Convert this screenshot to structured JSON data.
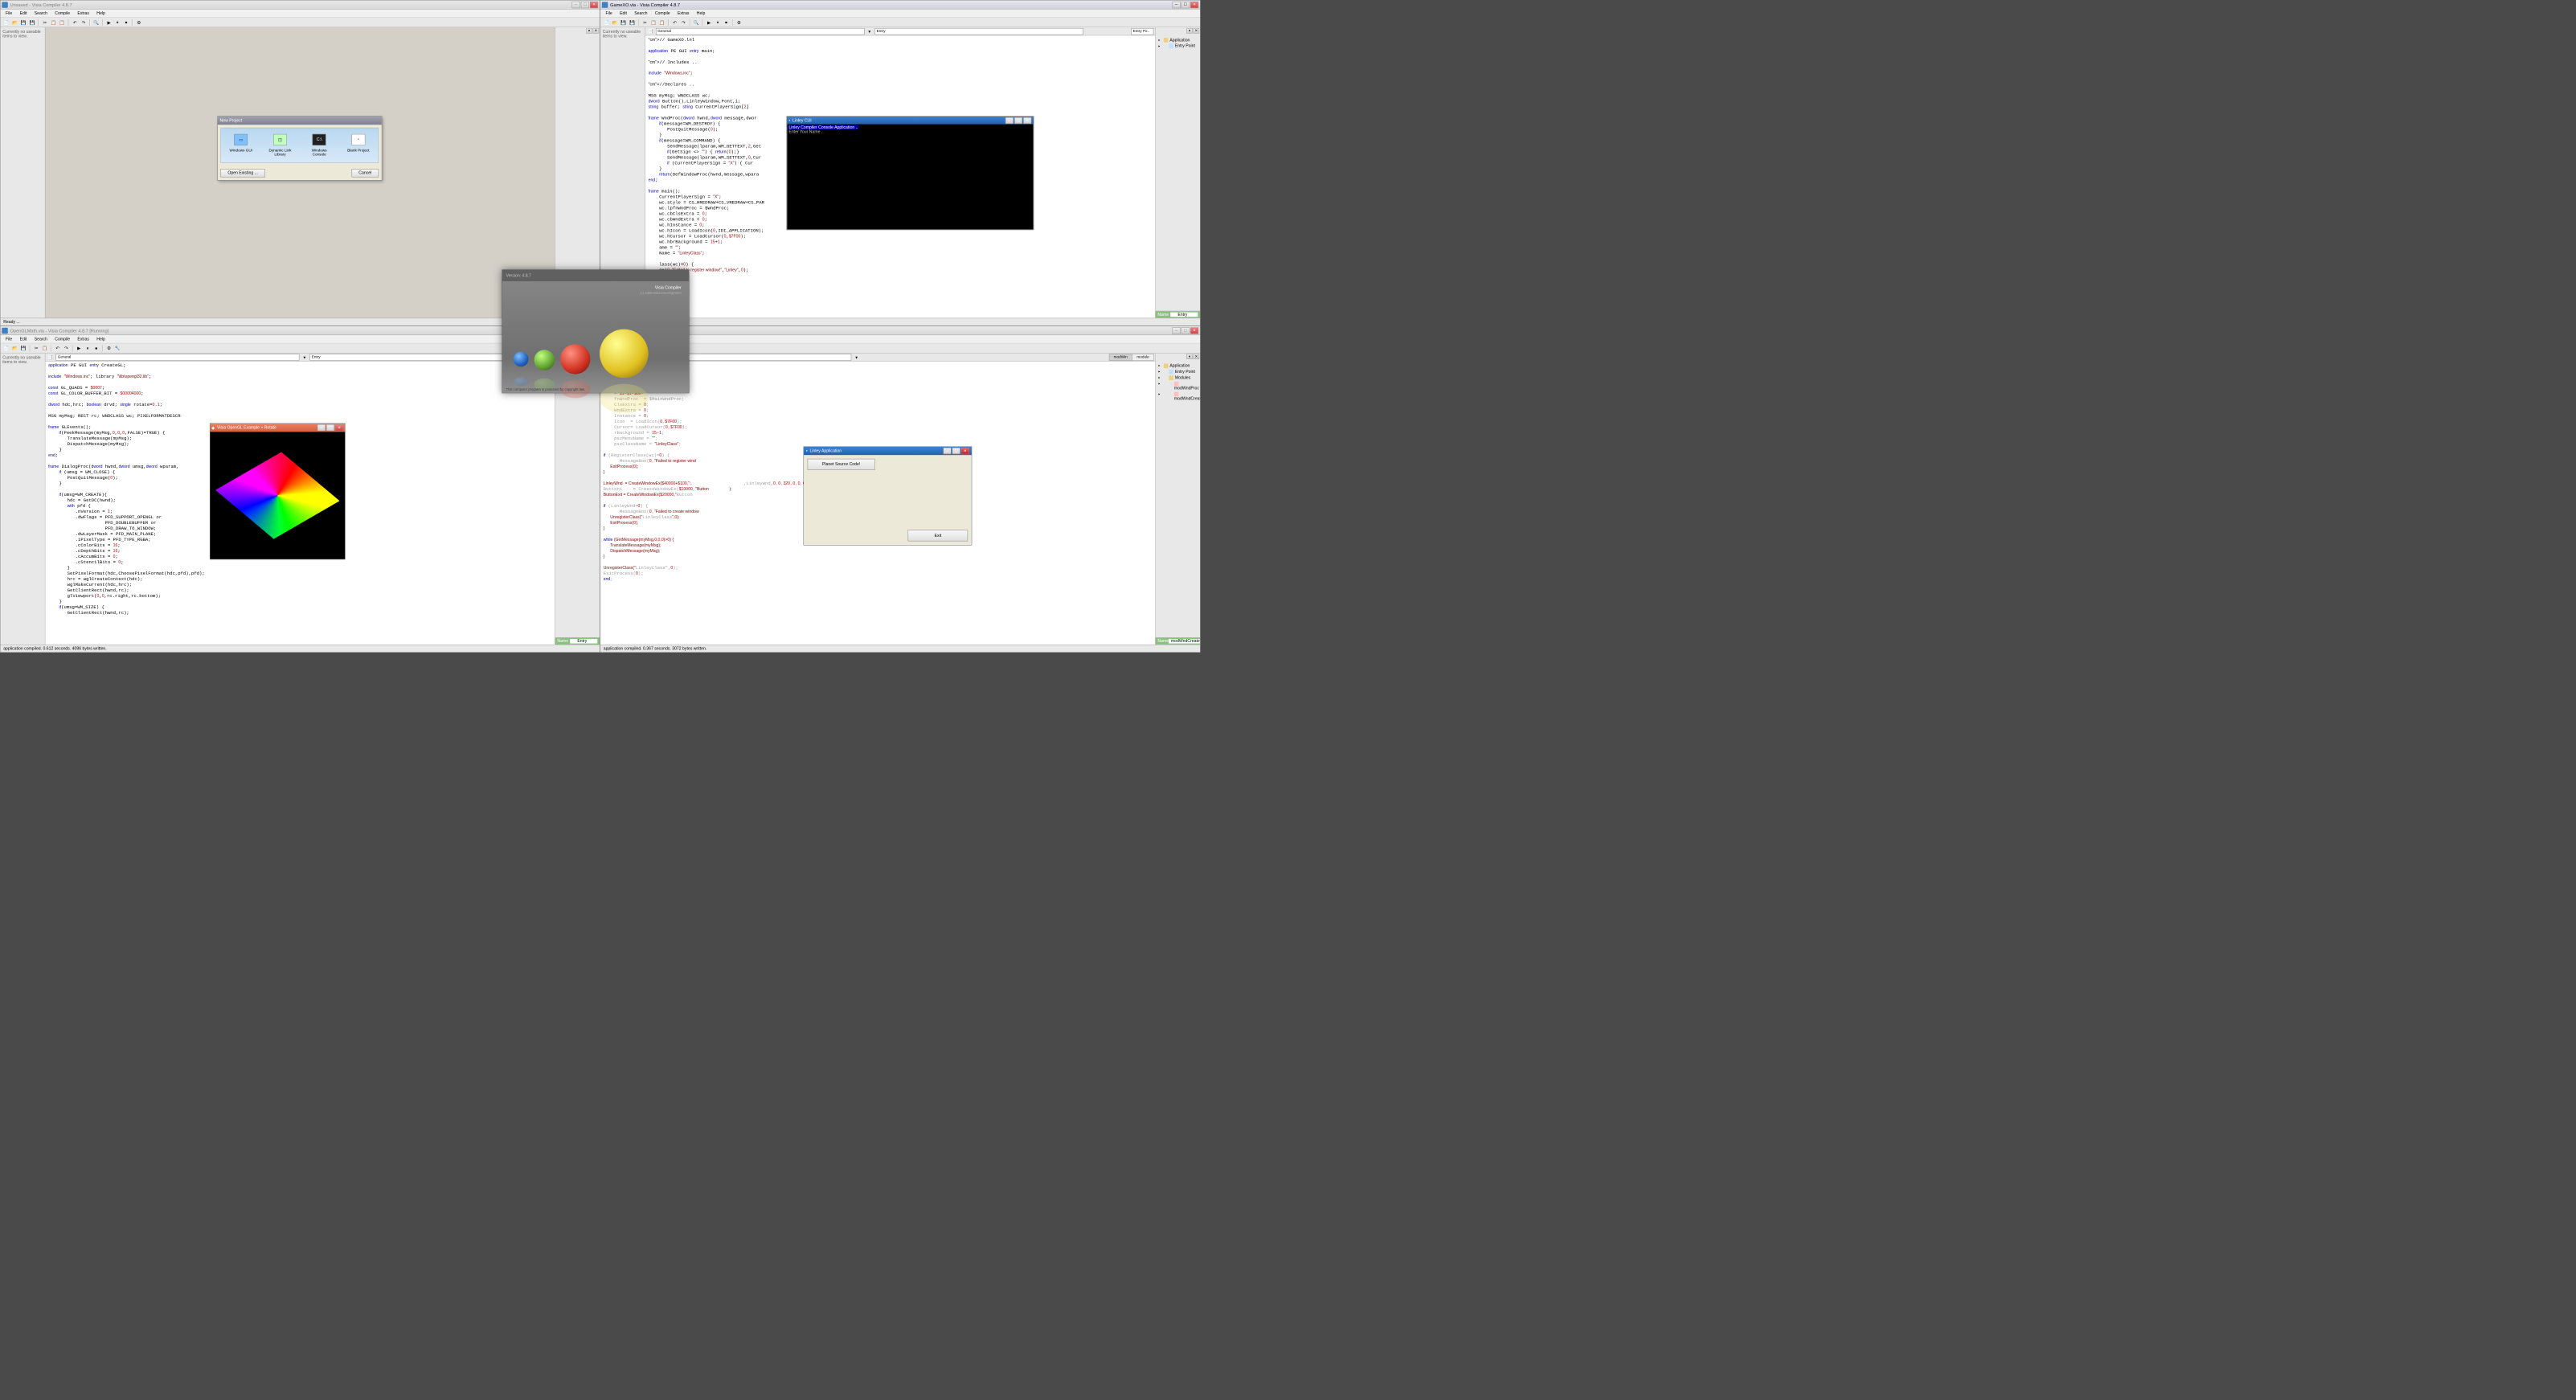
{
  "menus": [
    "File",
    "Edit",
    "Search",
    "Compile",
    "Extras",
    "Help"
  ],
  "toolbar_icons": [
    "📄",
    "📂",
    "💾",
    "💾",
    "|",
    "✂",
    "📋",
    "📋",
    "|",
    "↶",
    "↷",
    "|",
    "🔍",
    "|",
    "▶",
    "⏸",
    "⏹",
    "|",
    "⚙",
    "🔧"
  ],
  "ide1": {
    "title": "Unsaved  -  Visia Compiler 4.8.7",
    "sidebar": "Currently no useable items to view.",
    "status": "Ready ..."
  },
  "ide2": {
    "title": "GameXO.vla  -  Visia Compiler 4.8.7",
    "combo1": "General",
    "combo2": "Entry",
    "tree": {
      "app": "Application",
      "entry": "Entry Point"
    },
    "props_name": "Name",
    "status": ""
  },
  "ide3": {
    "title": "OpenGLMath.vla  -  Visia Compiler 4.8.7 [Running]",
    "combo1": "General",
    "combo2": "Entry",
    "props_name": "Name",
    "props_val": "Entry",
    "status": "application compiled. 0.612 seconds. 4096 bytes written."
  },
  "ide4": {
    "title": "",
    "tree": {
      "app": "Application",
      "entry": "Entry Point",
      "modules": "Modules",
      "m1": "modWndProc",
      "m2": "modWndCreate"
    },
    "tabs": [
      "modWin",
      "module"
    ],
    "props_name": "Name",
    "props_val": "modWndCreate",
    "status": "application compiled. 0.367 seconds. 3072 bytes written."
  },
  "new_project": {
    "title": "New Project",
    "options": [
      "Windows GUI",
      "Dynamic Link Library",
      "Windows Console",
      "Blank Project"
    ],
    "open": "Open Existing ...",
    "cancel": "Cancel"
  },
  "console": {
    "title": "Linley CUI",
    "line1": "Linley Compiler Console Application ..",
    "line2": "Enter Your Name .."
  },
  "gl_win": {
    "title": "Visia OpenGL Example » Rotate"
  },
  "splash": {
    "version": "Version: 4.8.7",
    "name": "Visia Compiler",
    "sub": "(c) 2006 Visia  Development",
    "foot": "This computer program is protected by copyright law."
  },
  "linley": {
    "title": "Linley Application",
    "btn1": "Planet Source Code!",
    "btn2": "Exit"
  },
  "code2": "// GameXO.lnl\n\napplication PE GUI entry main;\n\n// Includes ..\n\ninclude \"Windows.inc\";\n\n//Declares ..\n\nMSG myMsg; WNDCLASS wc;\ndword Button(),LinleyWindow,Font,i;\nstring buffer; string CurrentPlayerSign[2]\n\nframe WndProc(dword hwnd,dword message,dwor\n    if(message=WM_DESTROY) {\n       PostQuitMessage(0);\n    }\n    if(message=WM_COMMAND) {\n       SendMessage(lparam,WM_GETTEXT,2,Get\n       if(GetSign <> \"\") { return(0);}\n       SendMessage(lparam,WM_SETTEXT,0,Cur\n       if (CurrentPlayerSign = \"X\") { Cur\n    }\n    return(DefWindowProc(hwnd,message,wpara\nend;\n\nframe main();\n    CurrentPlayerSign = \"X\";\n    wc.style = CS_HREDRAW+CS_VREDRAW+CS_PAR\n    wc.lpfnWndProc = $WndProc;\n    wc.cbClsExtra = 0;\n    wc.cbWndExtra = 0;\n    wc.hInstance = 0;\n    wc.hIcon = LoadIcon(0,IDI_APPLICATION);\n    wc.hCursor = LoadCursor(0,$7F00);\n    wc.hbrBackground = 15+1;\n    ame = \"\";\n    Name = \"LinleyClass\";\n\n    lass(wc)=0) {\n    ox(0,\"Failed to register window!\",\"Linley\",0);\n    ess(0);",
  "code3": "application PE GUI entry CreateGL;\n\ninclude \"Windows.inc\"; library \"\\lib\\opengl32.lib\";\n\nconst GL_QUADS = $0007;\nconst GL_COLOR_BUFFER_BIT = $00004000;\n\ndword hdc,hrc; boolean drvd; single rotate=0.1;\n\nMSG myMsg; RECT rc; WNDCLASS wc; PIXELFORMATDESCR\n\nframe GLEvents();\n    if(PeekMessage(myMsg,0,0,0,FALSE)=TRUE) {\n       TranslateMessage(myMsg);\n       DispatchMessage(myMsg);\n    }\nend;\n\nframe DialogProc(dword hwnd,dword umsg,dword wparam,\n    if (umsg = WM_CLOSE) {\n       PostQuitMessage(0);\n    }\n\n    if(umsg=WM_CREATE){\n       hdc = GetDC(hwnd);\n       with pfd {\n          .nVersion = 1;\n          .dwFlags = PFD_SUPPORT_OPENGL or\n                     PFD_DOUBLEBUFFER or\n                     PFD_DRAW_TO_WINDOW;\n          .dwLayerMask = PFD_MAIN_PLANE;\n          .iPixelType = PFD_TYPE_RGBA;\n          .cColorBits = 16;\n          .cDepthBits = 16;\n          .cAccumBits = 0;\n          .cStencilBits = 0;\n       }\n       SetPixelFormat(hdc,ChoosePixelFormat(hdc,pfd),pfd);\n       hrc = wglCreateContext(hdc);\n       wglMakeCurrent(hdc,hrc);\n       GetClientRect(hwnd,rc);\n       glViewport(0,0,rc.right,rc.bottom);\n    }\n    if(umsg=WM_SIZE) {\n       GetClientRect(hwnd,rc);",
  "code4": "alog;\n\n    LinleyWnd;\n    dword Button1;\n    dword ButtonV1;\n    = $1=$1=$80-\n    fnWndProc  = $MainWndProc;\n    ClsExtra = 0;\n    WndExtra = 0;\n    Instance = 0;\n    Icon  = LoadIcon(0,$7F00);\n    Cursor= LoadCursor(0,$7F00);\n    rBackground = 15+1;\n    pszMenuName = \"\";\n    pszClassName = \"LinleyClass\";\n\nif (RegisterClass(wc)=0) {\n      MessageBox(0,\"Failed to register wind\n      ExitProcess(0);\n}\n\nLinleyWnd  = CreateWindowEx($40000+$100,\"L                   ,LinleyWnd,0,0,320,0,0,0);\nButton1    = CreateWindowEx($10000,\"Button                  );\nButtonExit = CreateWindowEx($20000,\"Button\n\nif (LinleyWnd=0) {\n      MessageBox(0,\"Failed to create window\n      UnregisterClass(\"LinleyClass\",0);\n      ExitProcess(0);\n}\n\nwhile (GetMessage(myMsg,0,0,0)>0) {\n      TranslateMessage(myMsg);\n      DispatchMessage(myMsg);\n}\n\nUnregisterClass(\"LinleyClass\",0);\nExitProcess(0);\nend;"
}
